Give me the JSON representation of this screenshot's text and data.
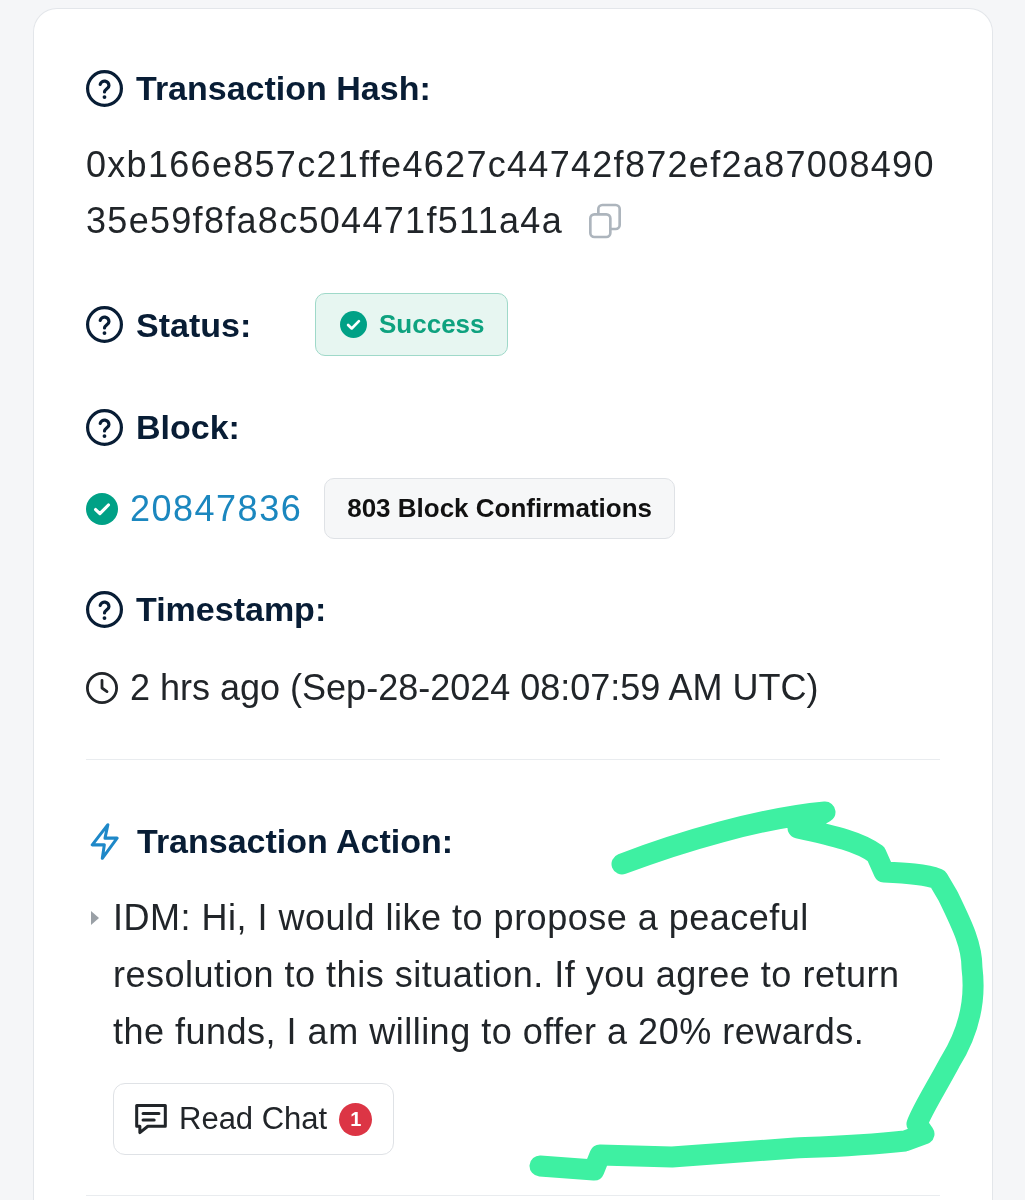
{
  "transaction_hash": {
    "label": "Transaction Hash:",
    "value_lines": [
      "0xb166e857c21ffe4627c44742f872ef2a87008490",
      "35e59f8fa8c504471f511a4a"
    ]
  },
  "status": {
    "label": "Status:",
    "value": "Success",
    "kind": "success"
  },
  "block": {
    "label": "Block:",
    "number": "20847836",
    "confirmed": true,
    "confirmations": "803 Block Confirmations"
  },
  "timestamp": {
    "label": "Timestamp:",
    "value": "2 hrs ago (Sep-28-2024 08:07:59 AM UTC)"
  },
  "transaction_action": {
    "label": "Transaction Action:",
    "message": "IDM: Hi, I would like to propose a peaceful resolution to this situation. If you agree to return the funds, I am willing to offer a 20% rewards.",
    "read_chat": {
      "label": "Read Chat",
      "count": "1"
    }
  }
}
